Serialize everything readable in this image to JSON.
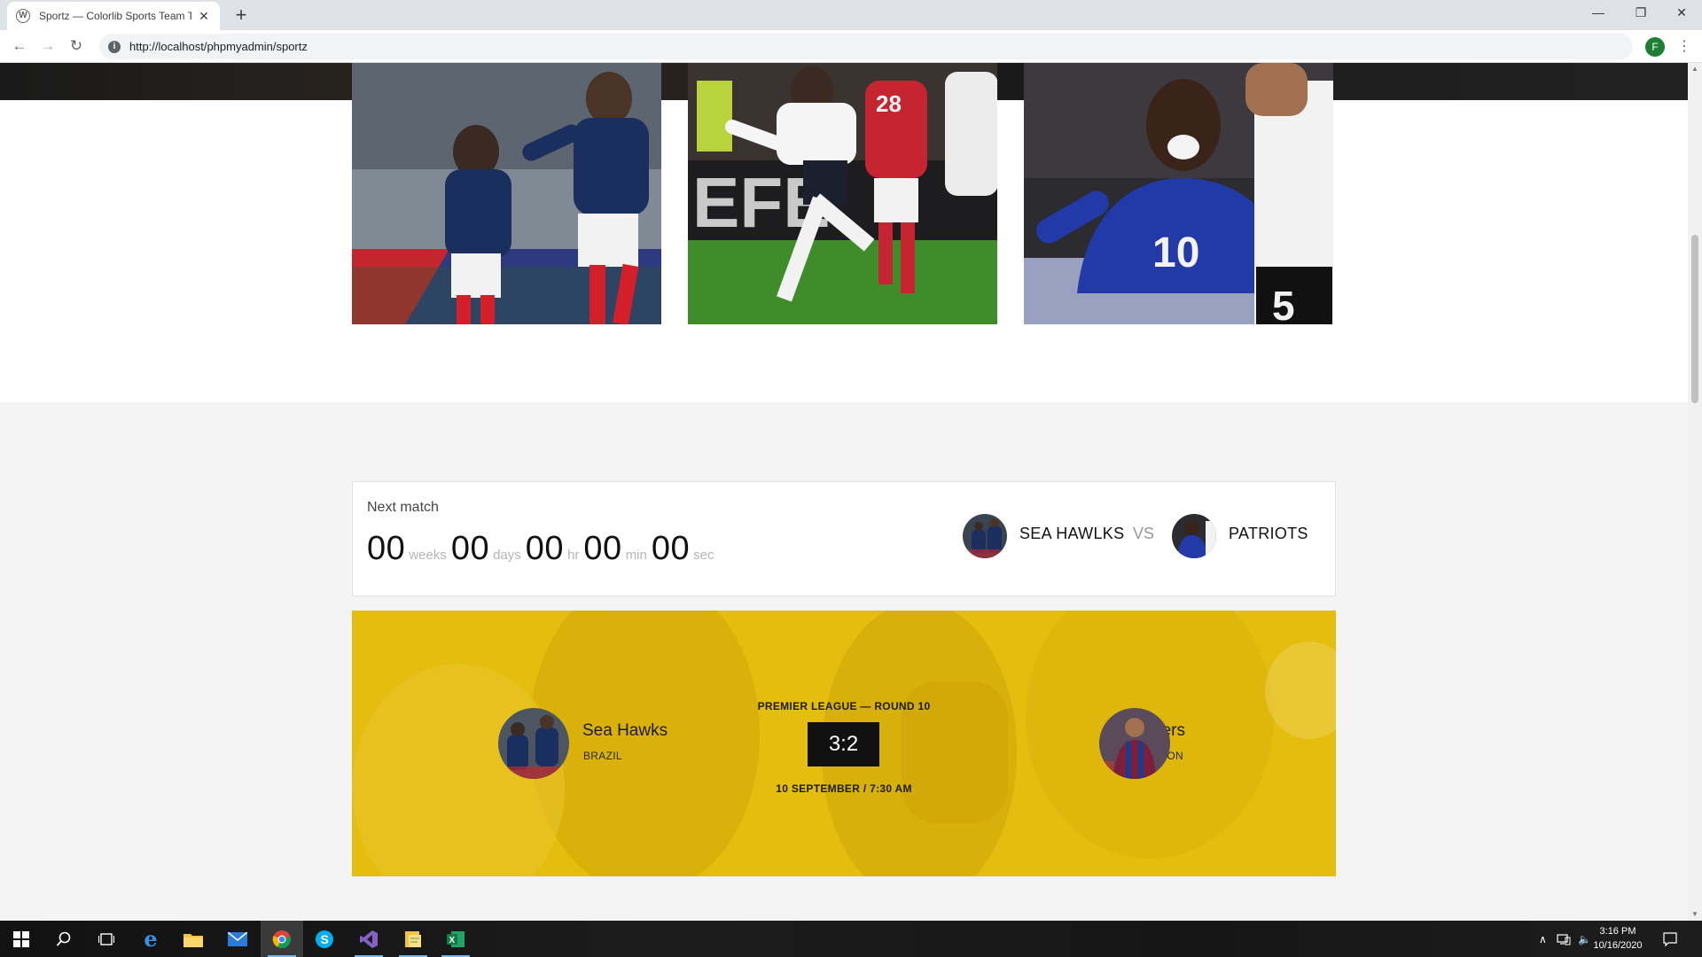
{
  "browser": {
    "tab_title": "Sportz — Colorlib Sports Team Te",
    "url": "http://localhost/phpmyadmin/sportz",
    "profile_initial": "F"
  },
  "next_match": {
    "label": "Next match",
    "countdown": [
      {
        "value": "00",
        "unit": "weeks"
      },
      {
        "value": "00",
        "unit": "days"
      },
      {
        "value": "00",
        "unit": "hr"
      },
      {
        "value": "00",
        "unit": "min"
      },
      {
        "value": "00",
        "unit": "sec"
      }
    ],
    "home_team": "SEA HAWLKS",
    "vs": "VS",
    "away_team": "PATRIOTS"
  },
  "result": {
    "league": "PREMIER LEAGUE — ROUND 10",
    "score": "3:2",
    "date": "10 SEPTEMBER / 7:30 AM",
    "home": {
      "name": "Sea Hawks",
      "location": "BRAZIL"
    },
    "away": {
      "name": "Steelers",
      "location": "LONDON"
    },
    "accent_color": "#e4bd0e"
  },
  "taskbar": {
    "time": "3:16 PM",
    "date": "10/16/2020"
  }
}
